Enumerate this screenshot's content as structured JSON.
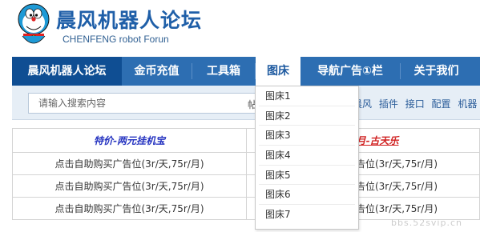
{
  "header": {
    "title": "晨风机器人论坛",
    "subtitle": "CHENFENG robot Forun"
  },
  "nav": {
    "items": [
      "晨风机器人论坛",
      "金币充值",
      "工具箱",
      "图床",
      "导航广告①栏",
      "关于我们"
    ],
    "active": "图床"
  },
  "search": {
    "placeholder": "请输入搜索内容",
    "type_label": "帖",
    "hot_links": [
      "晨风",
      "插件",
      "接口",
      "配置",
      "机器"
    ]
  },
  "ad_table": {
    "head_left": "特价-两元挂机宝",
    "head_right": "贪玩蓝月-古天乐",
    "rows": [
      [
        "点击自助购买广告位(3r/天,75r/月)",
        "点击自助购买广告位(3r/天,75r/月)"
      ],
      [
        "点击自助购买广告位(3r/天,75r/月)",
        "点击自助购买广告位(3r/天,75r/月)"
      ],
      [
        "点击自助购买广告位(3r/天,75r/月)",
        "点击自助购买广告位(3r/天,75r/月)"
      ]
    ]
  },
  "dropdown": {
    "items": [
      "图床1",
      "图床2",
      "图床3",
      "图床4",
      "图床5",
      "图床6",
      "图床7"
    ]
  },
  "watermark": {
    "text": "bbs.52svip.cn"
  },
  "colors": {
    "nav_bg": "#2d6eb2",
    "nav_home_bg": "#0f4e93",
    "title": "#1f5fa8",
    "ad_head_left": "#2533c0",
    "ad_head_right": "#d02020"
  }
}
